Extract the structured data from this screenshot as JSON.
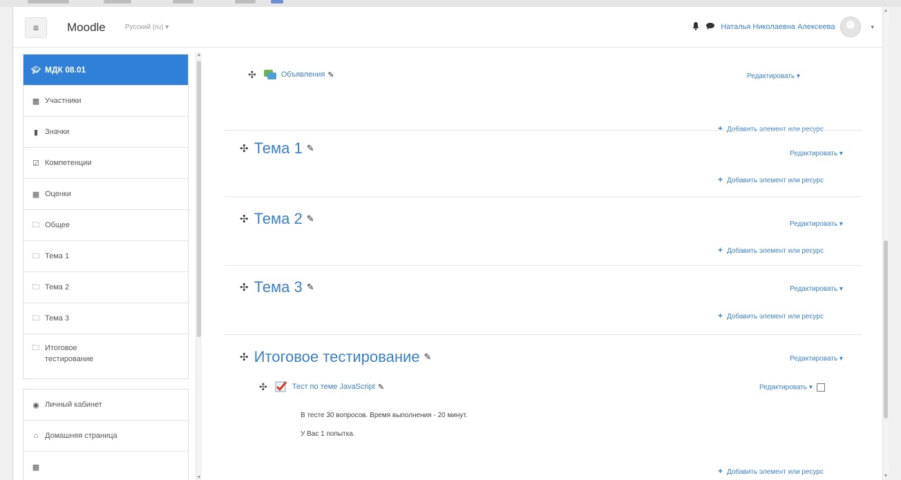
{
  "navbar": {
    "brand": "Moodle",
    "language": "Русский (ru) ▾",
    "user_name": "Наталья Николаевна Алексеева",
    "menu_caret": "▾"
  },
  "drawer": {
    "course": "МДК 08.01",
    "items": [
      {
        "label": "Участники",
        "icon": "users-icon"
      },
      {
        "label": "Значки",
        "icon": "shield-icon"
      },
      {
        "label": "Компетенции",
        "icon": "check-square-icon"
      },
      {
        "label": "Оценки",
        "icon": "grid-icon"
      },
      {
        "label": "Общее",
        "icon": "folder-icon"
      },
      {
        "label": "Тема 1",
        "icon": "folder-icon"
      },
      {
        "label": "Тема 2",
        "icon": "folder-icon"
      },
      {
        "label": "Тема 3",
        "icon": "folder-icon"
      },
      {
        "label": "Итоговое тестирование",
        "icon": "folder-icon"
      }
    ],
    "secondary": [
      {
        "label": "Личный кабинет",
        "icon": "dashboard-icon"
      },
      {
        "label": "Домашняя страница",
        "icon": "home-icon"
      }
    ]
  },
  "main": {
    "edit_label": "Редактировать",
    "add_label": "Добавить элемент или ресурс",
    "announcements": "Объявления",
    "sections": [
      "Тема 1",
      "Тема 2",
      "Тема 3",
      "Итоговое тестирование"
    ],
    "quiz": {
      "name": "Тест по теме JavaScript",
      "line1": "В тесте 30 вопросов. Время выполнения - 20 минут.",
      "line2": "У Вас 1 попытка."
    }
  },
  "colors": {
    "accent": "#2f80d6",
    "link": "#3b7fc4"
  }
}
